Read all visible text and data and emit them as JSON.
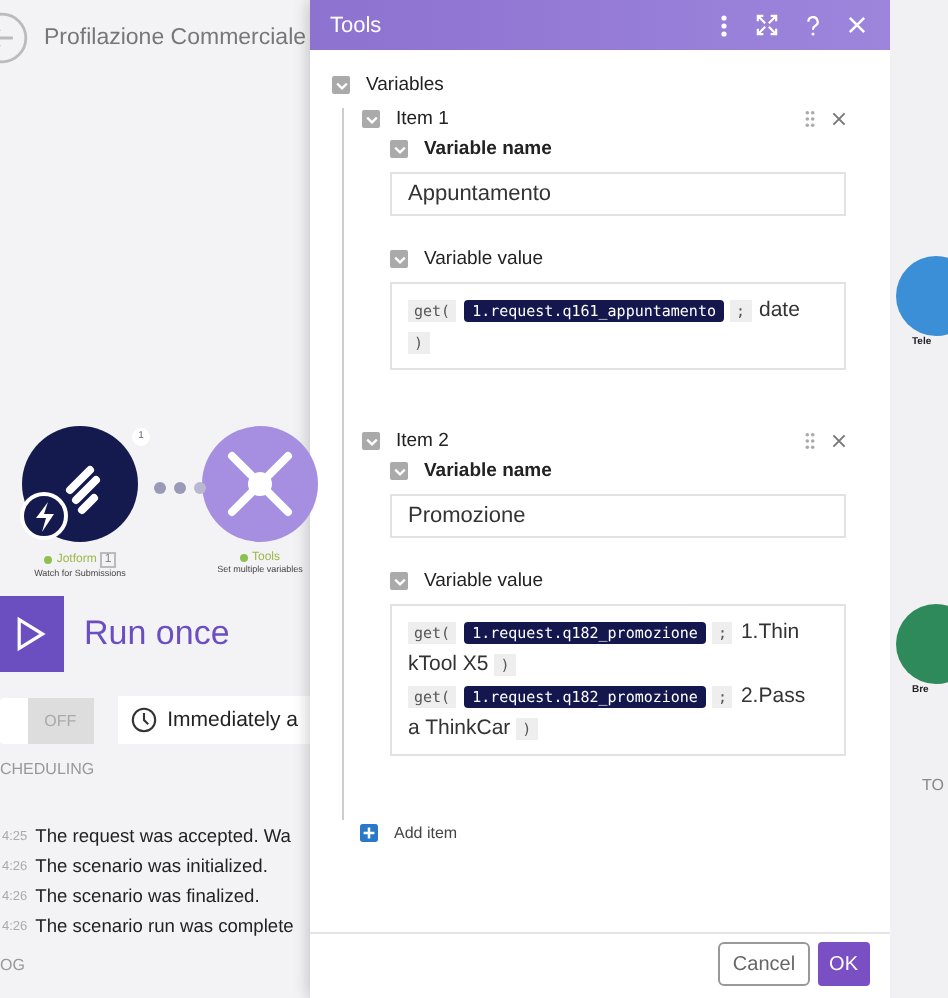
{
  "header": {
    "title": "Profilazione Commerciale"
  },
  "canvas": {
    "nodes": [
      {
        "name": "Jotform",
        "badge": "1",
        "subtitle": "Watch for Submissions",
        "kind": "jotform"
      },
      {
        "name": "Tools",
        "subtitle": "Set multiple variables",
        "kind": "tools"
      }
    ],
    "connector_badge": "1",
    "side_nodes": [
      {
        "label": "Tele",
        "kind": "blue"
      },
      {
        "label": "Bre",
        "kind": "green"
      }
    ],
    "side_caption": "TO"
  },
  "run": {
    "label": "Run once"
  },
  "scheduling": {
    "toggle": "OFF",
    "on": false,
    "timing": "Immediately a",
    "label": "CHEDULING"
  },
  "log": {
    "entries": [
      {
        "time": "4:25",
        "text": "The request was accepted. Wa"
      },
      {
        "time": "4:26",
        "text": "The scenario was initialized."
      },
      {
        "time": "4:26",
        "text": "The scenario was finalized."
      },
      {
        "time": "4:26",
        "text": "The scenario run was complete"
      }
    ],
    "label": "OG"
  },
  "dialog": {
    "title": "Tools",
    "section": {
      "label": "Variables",
      "expanded": true
    },
    "items": [
      {
        "label": "Item 1",
        "expanded": true,
        "name_label": "Variable name",
        "name_expanded": true,
        "name": "Appuntamento",
        "value_label": "Variable value",
        "value_expanded": true,
        "value": [
          {
            "kind": "func",
            "text": "get("
          },
          {
            "kind": "pill",
            "text": "1.request.q161_appuntamento"
          },
          {
            "kind": "func",
            "text": ";"
          },
          {
            "kind": "text",
            "text": "date"
          },
          {
            "kind": "break"
          },
          {
            "kind": "func",
            "text": ")"
          }
        ]
      },
      {
        "label": "Item 2",
        "expanded": true,
        "name_label": "Variable name",
        "name_expanded": true,
        "name": "Promozione",
        "value_label": "Variable value",
        "value_expanded": true,
        "value": [
          {
            "kind": "func",
            "text": "get("
          },
          {
            "kind": "pill",
            "text": "1.request.q182_promozione"
          },
          {
            "kind": "func",
            "text": ";"
          },
          {
            "kind": "text",
            "text": "1.Thin"
          },
          {
            "kind": "break"
          },
          {
            "kind": "text",
            "text": "kTool X5"
          },
          {
            "kind": "func",
            "text": ")"
          },
          {
            "kind": "break"
          },
          {
            "kind": "func",
            "text": "get("
          },
          {
            "kind": "pill",
            "text": "1.request.q182_promozione"
          },
          {
            "kind": "func",
            "text": ";"
          },
          {
            "kind": "text",
            "text": "2.Pass"
          },
          {
            "kind": "break"
          },
          {
            "kind": "text",
            "text": "a ThinkCar"
          },
          {
            "kind": "func",
            "text": ")"
          }
        ]
      }
    ],
    "add_item": "Add item",
    "buttons": [
      {
        "label": "Cancel",
        "kind": "secondary"
      },
      {
        "label": "OK",
        "kind": "primary"
      }
    ]
  }
}
